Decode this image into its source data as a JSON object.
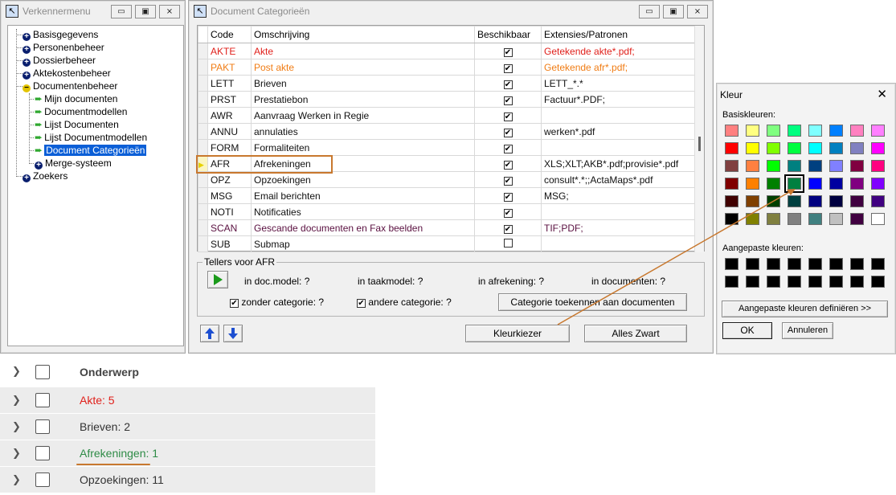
{
  "explorer": {
    "title": "Verkennermenu",
    "tree": [
      {
        "label": "Basisgegevens"
      },
      {
        "label": "Personenbeheer"
      },
      {
        "label": "Dossierbeheer"
      },
      {
        "label": "Aktekostenbeheer"
      },
      {
        "label": "Documentenbeheer"
      },
      {
        "label": "Mijn documenten"
      },
      {
        "label": "Documentmodellen"
      },
      {
        "label": "Lijst Documenten"
      },
      {
        "label": "Lijst Documentmodellen"
      },
      {
        "label": "Document Categorieën"
      },
      {
        "label": "Merge-systeem"
      },
      {
        "label": "Zoekers"
      }
    ]
  },
  "doccat": {
    "title": "Document Categorieën",
    "columns": [
      "Code",
      "Omschrijving",
      "Beschikbaar",
      "Extensies/Patronen"
    ],
    "rows": [
      {
        "code": "AKTE",
        "desc": "Akte",
        "checked": "✔",
        "ext": "Getekende akte*.pdf;",
        "color": "#e0201b"
      },
      {
        "code": "PAKT",
        "desc": "Post akte",
        "checked": "✔",
        "ext": "Getekende afr*.pdf;",
        "color": "#f07c14"
      },
      {
        "code": "LETT",
        "desc": "Brieven",
        "checked": "✔",
        "ext": "LETT_*.*",
        "color": "#111111"
      },
      {
        "code": "PRST",
        "desc": "Prestatiebon",
        "checked": "✔",
        "ext": "Factuur*.PDF;",
        "color": "#111111"
      },
      {
        "code": "AWR",
        "desc": "Aanvraag Werken in Regie",
        "checked": "✔",
        "ext": "",
        "color": "#111111"
      },
      {
        "code": "ANNU",
        "desc": "annulaties",
        "checked": "✔",
        "ext": "werken*.pdf",
        "color": "#111111"
      },
      {
        "code": "FORM",
        "desc": "Formaliteiten",
        "checked": "✔",
        "ext": "",
        "color": "#111111"
      },
      {
        "code": "AFR",
        "desc": "Afrekeningen",
        "checked": "✔",
        "ext": "XLS;XLT;AKB*.pdf;provisie*.pdf",
        "color": "#111111"
      },
      {
        "code": "OPZ",
        "desc": "Opzoekingen",
        "checked": "✔",
        "ext": "consult*.*;;ActaMaps*.pdf",
        "color": "#111111"
      },
      {
        "code": "MSG",
        "desc": "Email berichten",
        "checked": "✔",
        "ext": "MSG;",
        "color": "#111111"
      },
      {
        "code": "NOTI",
        "desc": "Notificaties",
        "checked": "✔",
        "ext": "",
        "color": "#111111"
      },
      {
        "code": "SCAN",
        "desc": "Gescande documenten en Fax beelden",
        "checked": "✔",
        "ext": "TIF;PDF;",
        "color": "#5a1040"
      },
      {
        "code": "SUB",
        "desc": "Submap",
        "checked": "",
        "ext": "",
        "color": "#111111"
      }
    ],
    "counters": {
      "group_label": "Tellers voor AFR",
      "in_docmodel": "in doc.model: ?",
      "in_taakmodel": "in taakmodel: ?",
      "in_afrekening": "in afrekening: ?",
      "in_documenten": "in documenten: ?",
      "zonder": "zonder categorie: ?",
      "andere": "andere categorie: ?",
      "assign_button": "Categorie toekennen aan documenten"
    },
    "buttons": {
      "kleurkiezer": "Kleurkiezer",
      "alles_zwart": "Alles Zwart"
    }
  },
  "colorpicker": {
    "title": "Kleur",
    "basic_label": "Basiskleuren:",
    "custom_label": "Aangepaste kleuren:",
    "define_button": "Aangepaste kleuren definiëren >>",
    "ok_button": "OK",
    "cancel_button": "Annuleren",
    "basic_colors": [
      "#ff8080",
      "#ffff80",
      "#80ff80",
      "#00ff80",
      "#80ffff",
      "#0080ff",
      "#ff80c0",
      "#ff80ff",
      "#ff0000",
      "#ffff00",
      "#80ff00",
      "#00ff40",
      "#00ffff",
      "#0080c0",
      "#8080c0",
      "#ff00ff",
      "#804040",
      "#ff8040",
      "#00ff00",
      "#008080",
      "#004080",
      "#8080ff",
      "#800040",
      "#ff0080",
      "#800000",
      "#ff8000",
      "#008000",
      "#008040",
      "#0000ff",
      "#0000a0",
      "#800080",
      "#8000ff",
      "#400000",
      "#804000",
      "#004000",
      "#004040",
      "#000080",
      "#000040",
      "#400040",
      "#400080",
      "#000000",
      "#808000",
      "#808040",
      "#808080",
      "#408080",
      "#c0c0c0",
      "#400040",
      "#ffffff"
    ],
    "selected_index": 27
  },
  "list": {
    "header": "Onderwerp",
    "items": [
      {
        "label": "Akte: 5",
        "color": "#e0201b"
      },
      {
        "label": "Brieven: 2",
        "color": "#333333"
      },
      {
        "label": "Afrekeningen: 1",
        "color": "#2e8b46"
      },
      {
        "label": "Opzoekingen: 11",
        "color": "#333333"
      }
    ]
  },
  "colors": {
    "accent": "#c8782e",
    "selection": "#0b5fd7"
  }
}
